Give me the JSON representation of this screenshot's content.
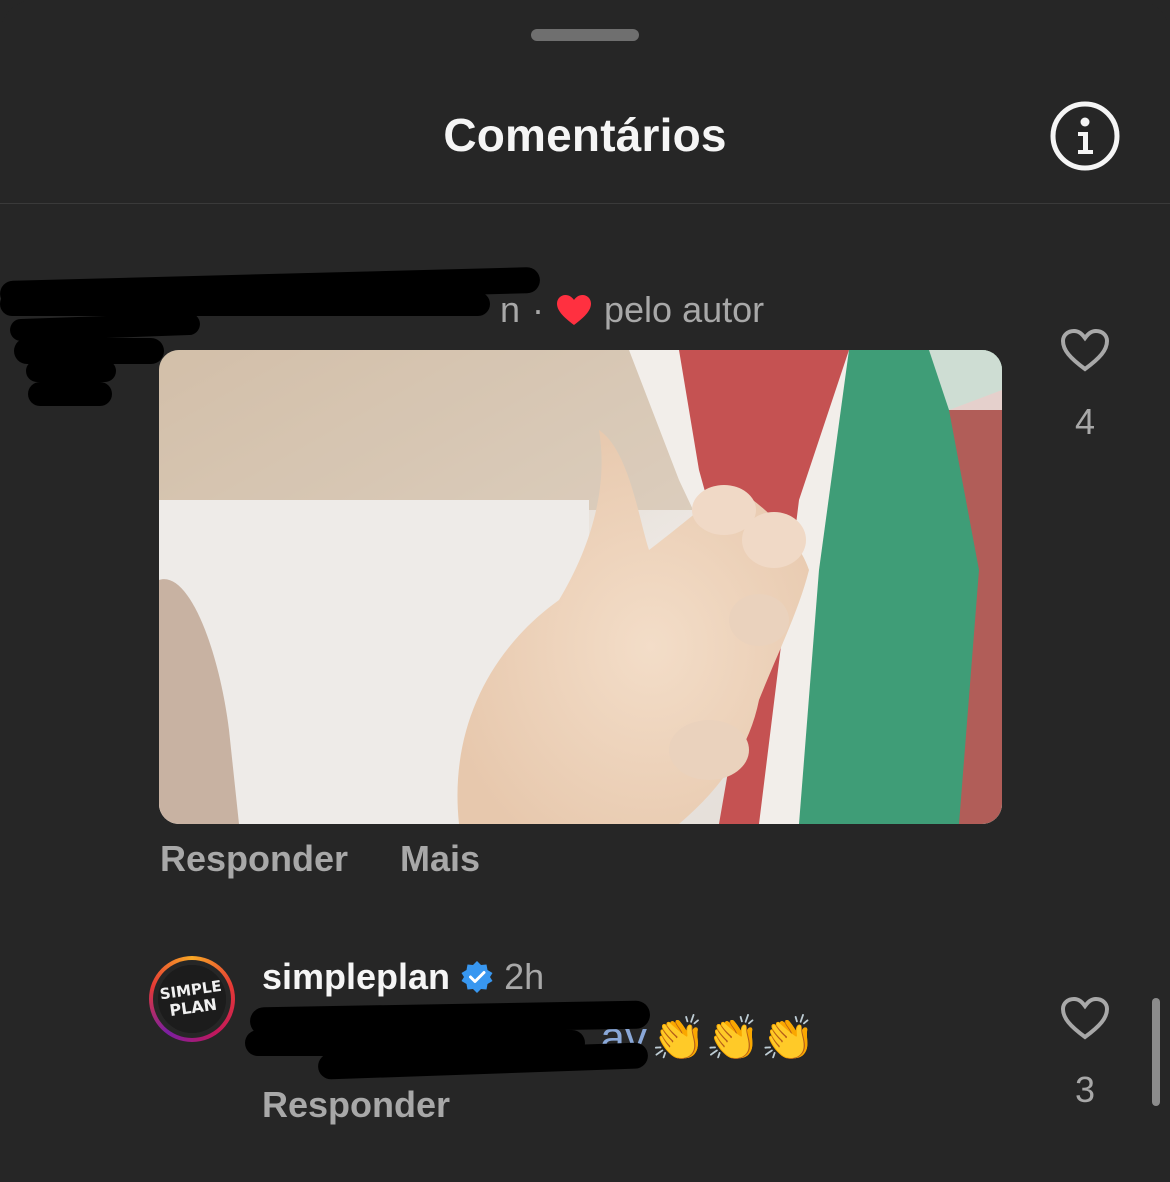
{
  "header": {
    "title": "Comentários",
    "info_icon": "info-circle-icon"
  },
  "comment_1": {
    "username_partial": "n",
    "separator": "·",
    "liked_by_author": "pelo autor",
    "like_count": "4",
    "actions": {
      "reply": "Responder",
      "more": "Mais"
    }
  },
  "comment_2": {
    "username": "simpleplan",
    "verified_icon": "verified-badge-icon",
    "time": "2h",
    "text_partial": "av",
    "emoji": "👏👏👏",
    "like_count": "3",
    "actions": {
      "reply": "Responder"
    }
  },
  "colors": {
    "background": "#262626",
    "text_primary": "#f5f5f5",
    "text_secondary": "#a8a8a8",
    "heart_red": "#ff3040",
    "verified_blue": "#3897f0"
  }
}
